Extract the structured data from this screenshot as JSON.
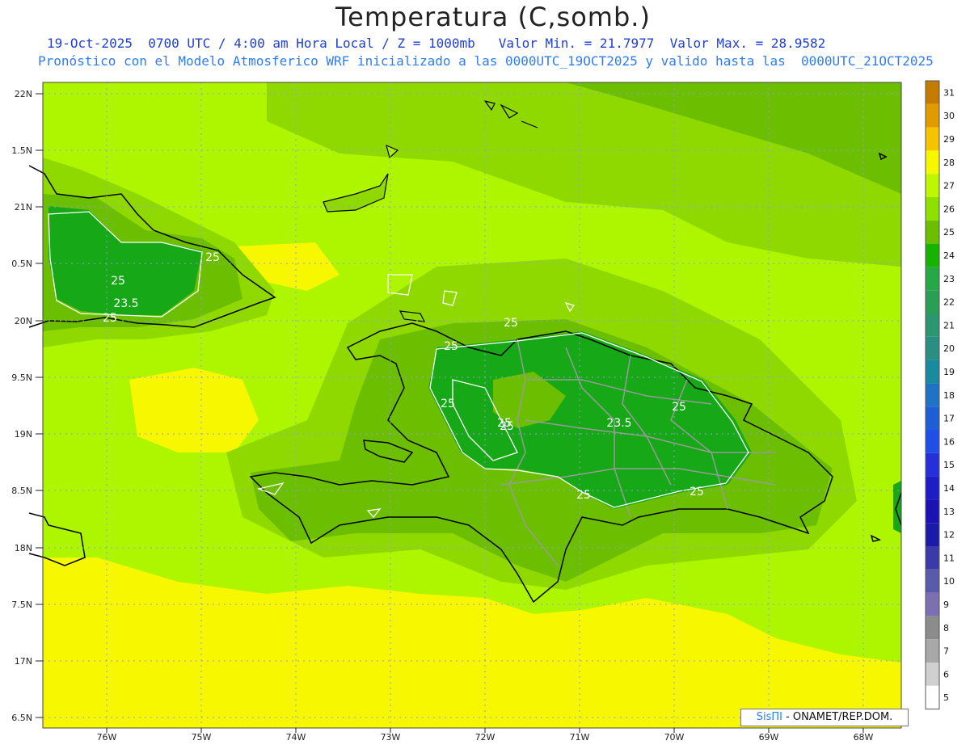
{
  "title": "Temperatura (C,somb.)",
  "subtitle_line1": "19-Oct-2025  0700 UTC / 4:00 am Hora Local / Z = 1000mb   Valor Min. = 21.7977  Valor Max. = 28.9582",
  "subtitle_line2": "Pronóstico con el Modelo Atmosferico WRF inicializado a las 0000UTC_19OCT2025 y valido hasta las  0000UTC_21OCT2025",
  "credit": {
    "brand": "SisПI",
    "org": " - ONAMET/REP.DOM."
  },
  "lat_labels": [
    "22N",
    "1.5N",
    "21N",
    "0.5N",
    "20N",
    "9.5N",
    "19N",
    "8.5N",
    "18N",
    "7.5N",
    "17N",
    "6.5N"
  ],
  "lon_labels": [
    "76W",
    "75W",
    "74W",
    "73W",
    "72W",
    "71W",
    "70W",
    "69W",
    "68W"
  ],
  "contour_labels": [
    "25",
    "25",
    "23.5",
    "25",
    "25",
    "25",
    "25",
    "25",
    "23.5",
    "25",
    "25",
    "25",
    "25"
  ],
  "colorbar": {
    "labels": [
      "31",
      "30",
      "29",
      "28",
      "27",
      "26",
      "25",
      "24",
      "23",
      "22",
      "21",
      "20",
      "19",
      "18",
      "17",
      "16",
      "15",
      "14",
      "13",
      "12",
      "11",
      "10",
      "9",
      "8",
      "7",
      "6",
      "5"
    ],
    "colors": [
      "#c47c00",
      "#e09b00",
      "#f5c400",
      "#f7f700",
      "#bdf700",
      "#8fe000",
      "#6cbf00",
      "#18b200",
      "#25a845",
      "#2a9e55",
      "#2c9670",
      "#2b8e82",
      "#1a8a9e",
      "#1f72c4",
      "#1f5fd6",
      "#1f4fe6",
      "#2530d8",
      "#1d1ec6",
      "#1a12b2",
      "#1c1aa8",
      "#3a3aa8",
      "#5a5aaa",
      "#7c70b0",
      "#8c8c8c",
      "#a8a8a8",
      "#d0d0d0",
      "#ffffff"
    ]
  },
  "colors": {
    "sea_yellow": "#f5f500",
    "yellow_green": "#aef500",
    "light_green": "#8fd900",
    "mid_green": "#6cbf00",
    "dark_green": "#16a817"
  }
}
